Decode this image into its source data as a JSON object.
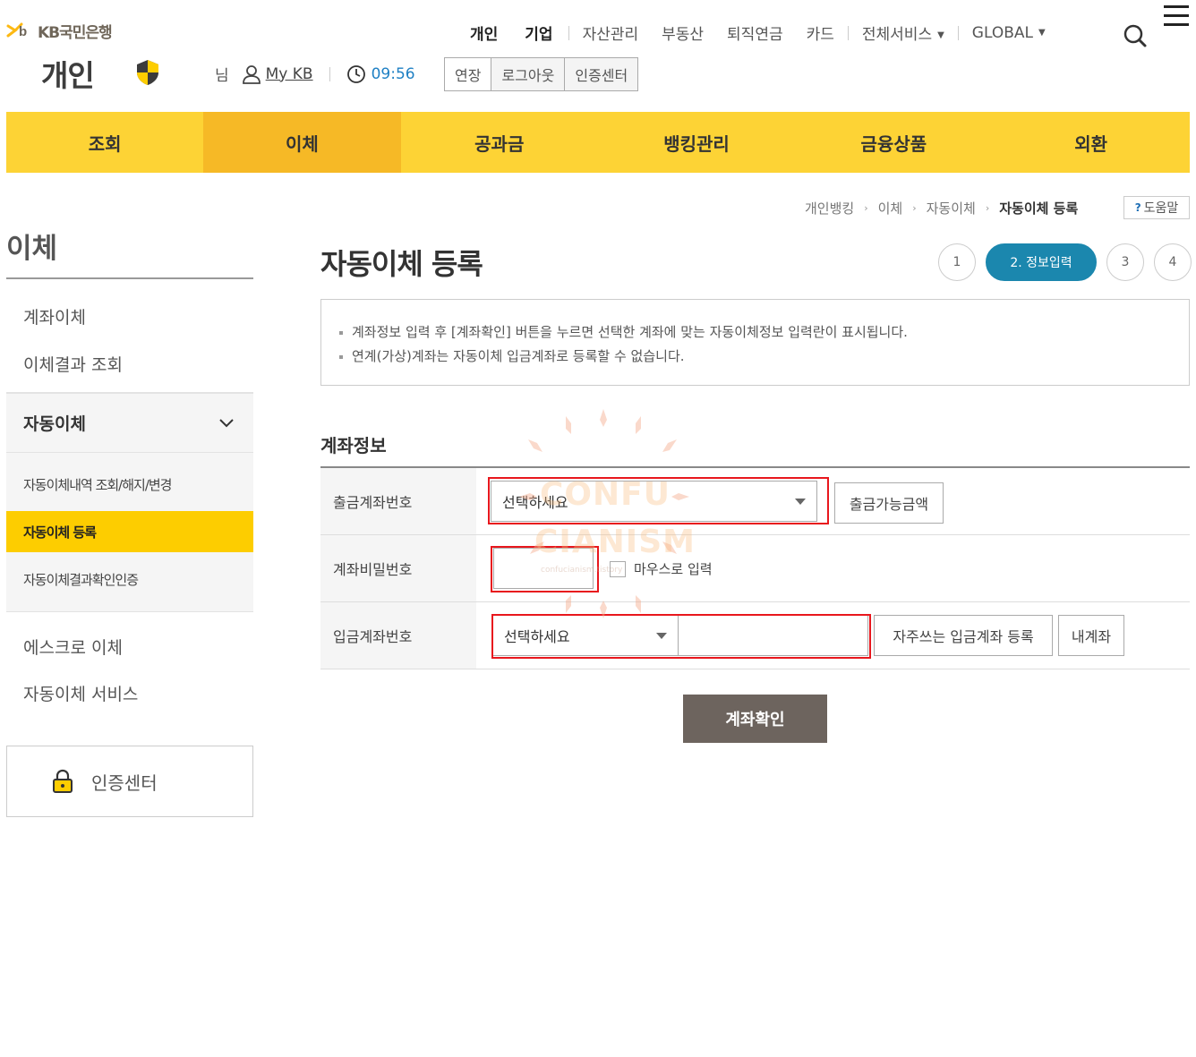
{
  "header": {
    "logo_text": "KB국민은행",
    "section_title": "개인",
    "top_nav": [
      "개인",
      "기업",
      "자산관리",
      "부동산",
      "퇴직연금",
      "카드",
      "전체서비스",
      "GLOBAL"
    ],
    "user_suffix": "님",
    "mykb_label": "My KB",
    "session_time": "09:56",
    "session_buttons": [
      "연장",
      "로그아웃",
      "인증센터"
    ]
  },
  "gnb": [
    "조회",
    "이체",
    "공과금",
    "뱅킹관리",
    "금융상품",
    "외환"
  ],
  "lnb": {
    "title": "이체",
    "items_top": [
      "계좌이체",
      "이체결과 조회"
    ],
    "group_title": "자동이체",
    "group_items": [
      "자동이체내역 조회/해지/변경",
      "자동이체 등록",
      "자동이체결과확인인증"
    ],
    "items_bottom": [
      "에스크로 이체",
      "자동이체 서비스"
    ],
    "cert_center": "인증센터"
  },
  "breadcrumb": [
    "개인뱅킹",
    "이체",
    "자동이체",
    "자동이체 등록"
  ],
  "help_label": "도움말",
  "page_title": "자동이체 등록",
  "steps": [
    "1",
    "2. 정보입력",
    "3",
    "4"
  ],
  "notice": [
    "계좌정보 입력 후 [계좌확인] 버튼을 누르면 선택한 계좌에 맞는 자동이체정보 입력란이 표시됩니다.",
    "연계(가상)계좌는 자동이체 입금계좌로 등록할 수 없습니다."
  ],
  "form": {
    "title": "계좌정보",
    "withdraw_label": "출금계좌번호",
    "withdraw_select": "선택하세요",
    "withdraw_btn": "출금가능금액",
    "password_label": "계좌비밀번호",
    "mouse_input": "마우스로 입력",
    "deposit_label": "입금계좌번호",
    "deposit_select": "선택하세요",
    "deposit_input": "",
    "freq_btn": "자주쓰는 입금계좌 등록",
    "my_account_btn": "내계좌",
    "confirm_btn": "계좌확인"
  },
  "watermark": {
    "line1": "CONFU",
    "line2": "CIANISM",
    "line3": "confucianism.tistory"
  },
  "colors": {
    "gnb": "#fdd335",
    "gnb_active": "#f6b926",
    "lnb_active": "#fdcd00",
    "step_active": "#1b87ae",
    "confirm": "#6d645e",
    "highlight": "#e8171d"
  }
}
